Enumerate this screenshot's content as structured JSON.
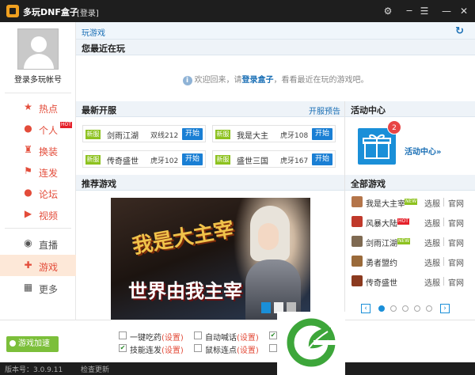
{
  "titlebar": {
    "app_name": "多玩DNF盒子",
    "login": "[登录]"
  },
  "sidebar": {
    "account": "登录多玩帐号",
    "items": [
      {
        "label": "热点",
        "icon": "star-icon"
      },
      {
        "label": "个人",
        "icon": "person-icon",
        "badge": "HOT"
      },
      {
        "label": "换装",
        "icon": "clothes-icon"
      },
      {
        "label": "连发",
        "icon": "rapid-fire-icon"
      },
      {
        "label": "论坛",
        "icon": "forum-icon"
      },
      {
        "label": "视频",
        "icon": "video-icon"
      },
      {
        "label": "直播",
        "icon": "live-icon"
      },
      {
        "label": "游戏",
        "icon": "gamepad-icon",
        "active": true
      },
      {
        "label": "更多",
        "icon": "more-icon"
      }
    ]
  },
  "content": {
    "crumb": "玩游戏",
    "recent": {
      "title": "您最近在玩",
      "msg_pre": "欢迎回来，请",
      "msg_link": "登录盒子",
      "msg_post": "，看看最近在玩的游戏吧。"
    },
    "new_servers": {
      "title": "最新开服",
      "forecast": "开服预告",
      "list": [
        {
          "tag": "新服",
          "game": "剑雨江湖",
          "zone": "双线212",
          "btn": "开始"
        },
        {
          "tag": "新服",
          "game": "我是大主",
          "zone": "虎牙108",
          "btn": "开始"
        },
        {
          "tag": "新服",
          "game": "传奇盛世",
          "zone": "虎牙102",
          "btn": "开始"
        },
        {
          "tag": "新服",
          "game": "盛世三国",
          "zone": "虎牙167",
          "btn": "开始"
        }
      ]
    },
    "activity": {
      "title": "活动中心",
      "badge": "2",
      "link": "活动中心»"
    },
    "recommend": {
      "title": "推荐游戏",
      "banner_logo": "我是大主宰",
      "banner_slogan": "世界由我主宰"
    },
    "all_games": {
      "title": "全部游戏",
      "list": [
        {
          "name": "我是大主宰",
          "tag": "NEW",
          "sel": "选服",
          "web": "官网",
          "color": "#b4754a"
        },
        {
          "name": "风暴大陆",
          "tag": "HOT",
          "sel": "选服",
          "web": "官网",
          "color": "#c0392b"
        },
        {
          "name": "剑雨江湖",
          "tag": "NEW",
          "sel": "选服",
          "web": "官网",
          "color": "#7f6a52"
        },
        {
          "name": "勇者盟约",
          "tag": "",
          "sel": "选服",
          "web": "官网",
          "color": "#9a6a3a"
        },
        {
          "name": "传奇盛世",
          "tag": "",
          "sel": "选服",
          "web": "官网",
          "color": "#8b3a1f"
        }
      ]
    }
  },
  "bottom": {
    "speed_btn": "游戏加速",
    "options": [
      {
        "text": "一键吃药",
        "set": "(设置)",
        "checked": false
      },
      {
        "text": "自动喊话",
        "set": "(设置)",
        "checked": false
      },
      {
        "text": "技能连发",
        "set": "(设置)",
        "checked": true
      },
      {
        "text": "鼠标连点",
        "set": "(设置)",
        "checked": false
      }
    ]
  },
  "status": {
    "version": "版本号：3.0.9.11",
    "update": "检查更新"
  }
}
